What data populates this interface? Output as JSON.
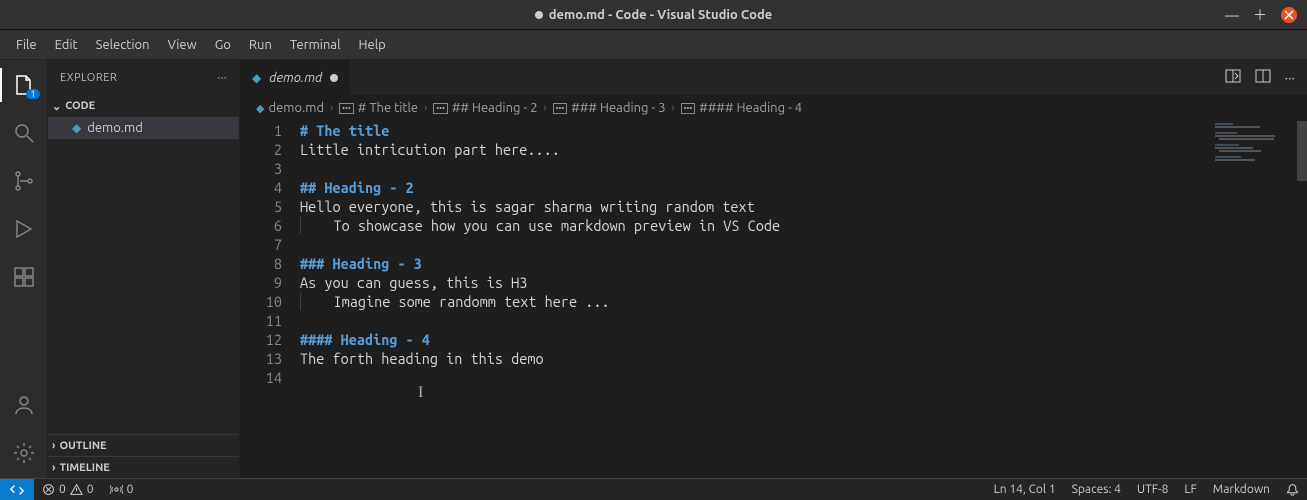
{
  "titlebar": {
    "modified": true,
    "title": "demo.md - Code - Visual Studio Code"
  },
  "menu": {
    "file": "File",
    "edit": "Edit",
    "selection": "Selection",
    "view": "View",
    "go": "Go",
    "run": "Run",
    "terminal": "Terminal",
    "help": "Help"
  },
  "activity_badge": "1",
  "sidebar": {
    "title": "EXPLORER",
    "root": "CODE",
    "file": "demo.md",
    "outline": "OUTLINE",
    "timeline": "TIMELINE"
  },
  "tab": {
    "label": "demo.md"
  },
  "breadcrumbs": {
    "b0": "demo.md",
    "b1": "# The title",
    "b2": "## Heading - 2",
    "b3": "### Heading - 3",
    "b4": "#### Heading - 4"
  },
  "editor": {
    "l1": "# The title",
    "l2": "Little intricution part here....",
    "l3": "",
    "l4": "## Heading - 2",
    "l5": "Hello everyone, this is sagar sharma writing random text",
    "l6a": "    ",
    "l6b": "To showcase how you can use markdown preview in VS Code",
    "l7": "",
    "l8": "### Heading - 3",
    "l9": "As you can guess, this is H3",
    "l10a": "    ",
    "l10b": "Imagine some randomm text here ...",
    "l11": "",
    "l12": "#### Heading - 4",
    "l13": "The forth heading in this demo",
    "l14": ""
  },
  "line_numbers": {
    "n1": "1",
    "n2": "2",
    "n3": "3",
    "n4": "4",
    "n5": "5",
    "n6": "6",
    "n7": "7",
    "n8": "8",
    "n9": "9",
    "n10": "10",
    "n11": "11",
    "n12": "12",
    "n13": "13",
    "n14": "14"
  },
  "status": {
    "errors": "0",
    "warnings": "0",
    "ports_label": "0",
    "ln_col": "Ln 14, Col 1",
    "spaces": "Spaces: 4",
    "encoding": "UTF-8",
    "eol": "LF",
    "language": "Markdown"
  }
}
